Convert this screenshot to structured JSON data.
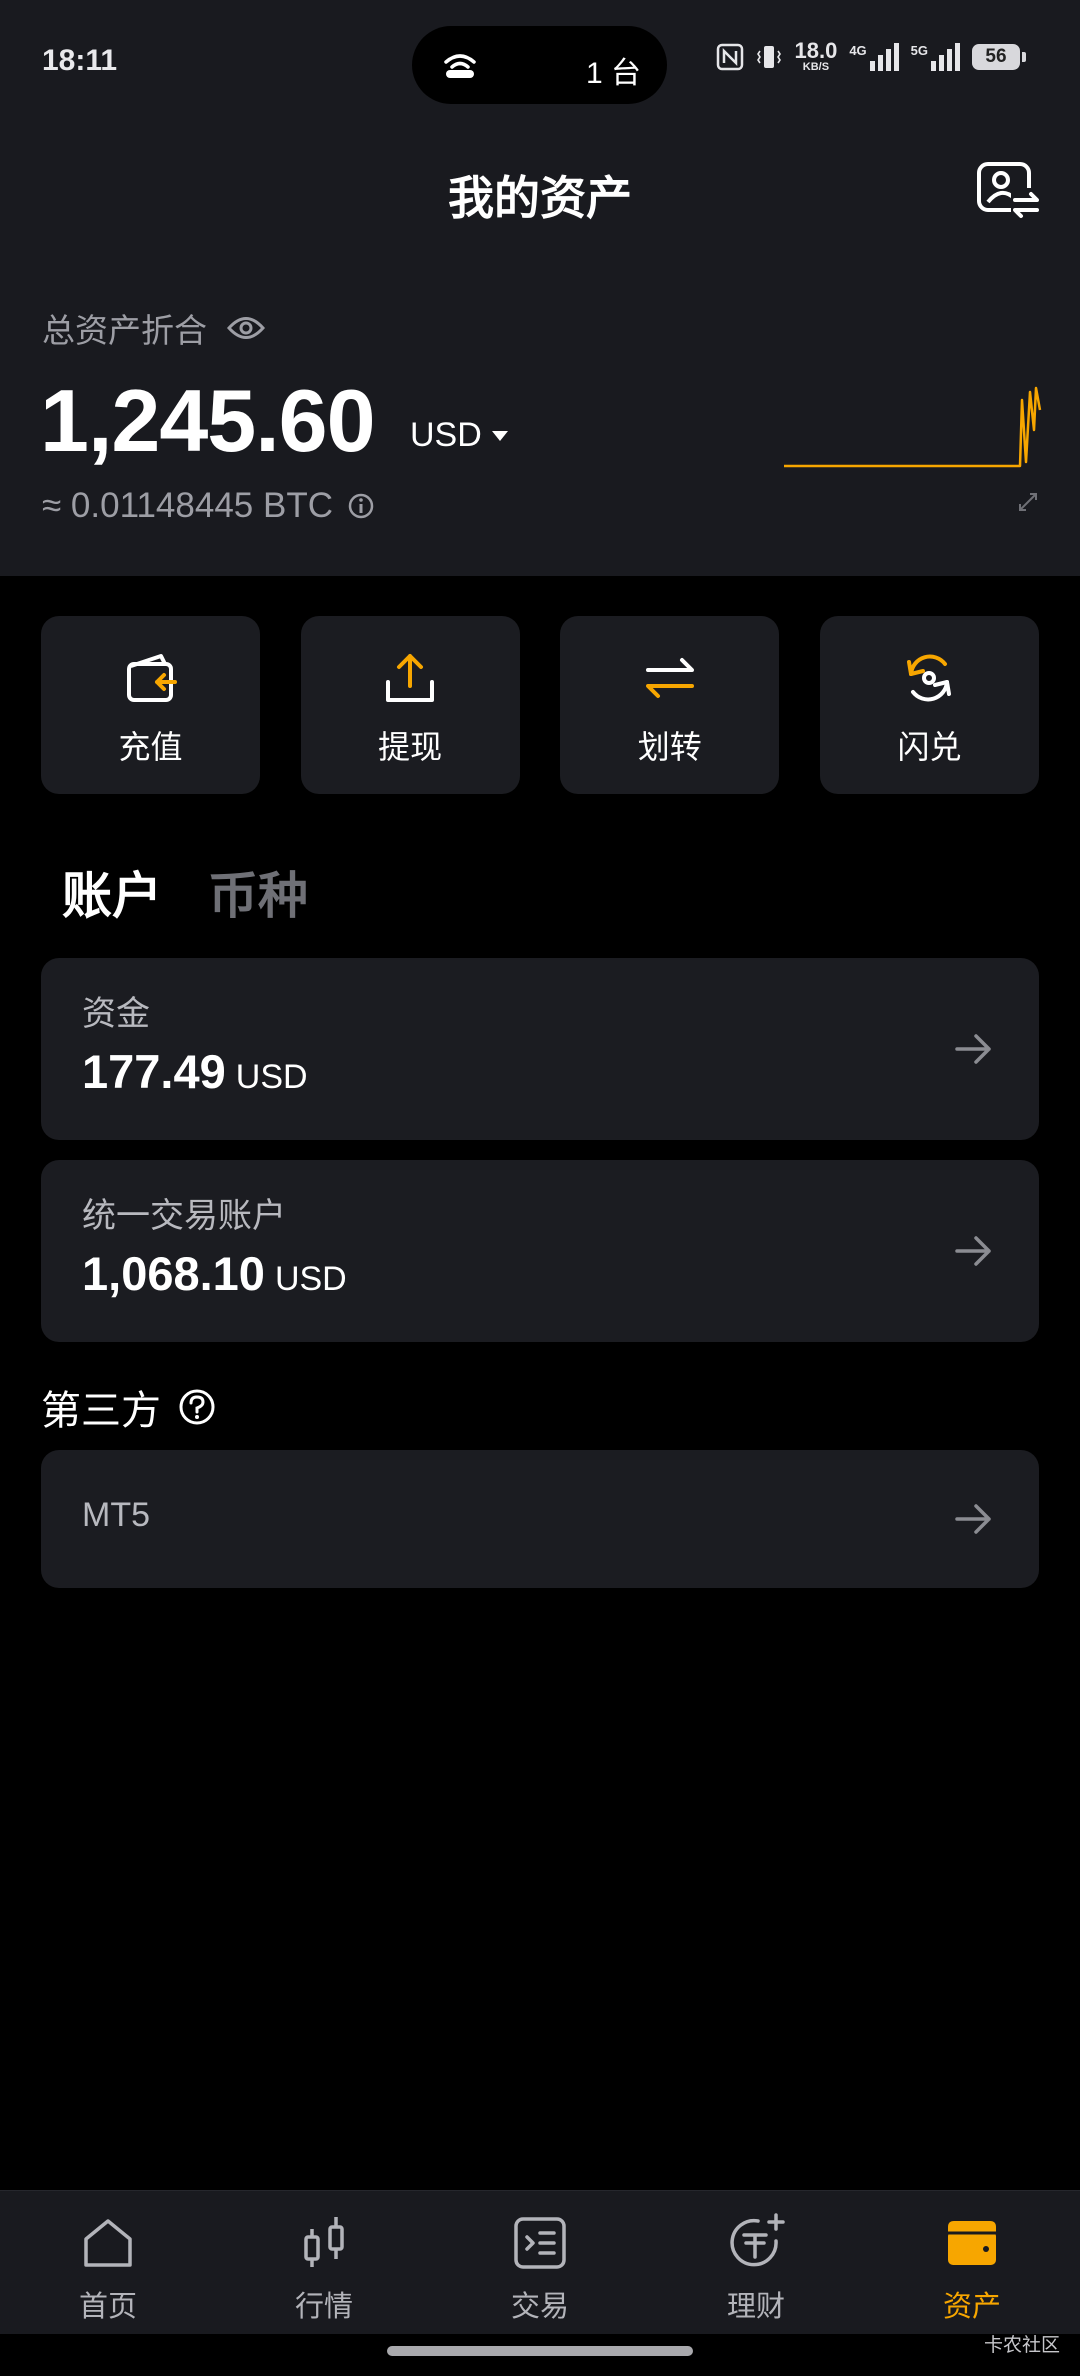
{
  "status_bar": {
    "time": "18:11",
    "island_text": "1 台",
    "net_speed_value": "18.0",
    "net_speed_unit": "KB/S",
    "signal1_label": "4G",
    "signal2_label": "5G",
    "battery": "56"
  },
  "header": {
    "title": "我的资产"
  },
  "summary": {
    "label": "总资产折合",
    "amount": "1,245.60",
    "currency": "USD",
    "btc": "≈ 0.01148445 BTC"
  },
  "actions": [
    {
      "label": "充值",
      "icon": "deposit-icon"
    },
    {
      "label": "提现",
      "icon": "withdraw-icon"
    },
    {
      "label": "划转",
      "icon": "transfer-icon"
    },
    {
      "label": "闪兑",
      "icon": "convert-icon"
    }
  ],
  "tabs": [
    {
      "label": "账户",
      "active": true
    },
    {
      "label": "币种",
      "active": false
    }
  ],
  "accounts": [
    {
      "name": "资金",
      "amount": "177.49",
      "unit": "USD"
    },
    {
      "name": "统一交易账户",
      "amount": "1,068.10",
      "unit": "USD"
    }
  ],
  "third_party": {
    "label": "第三方",
    "items": [
      {
        "name": "MT5"
      }
    ]
  },
  "bottom_nav": [
    {
      "label": "首页",
      "icon": "home-icon"
    },
    {
      "label": "行情",
      "icon": "candlestick-icon"
    },
    {
      "label": "交易",
      "icon": "trade-icon"
    },
    {
      "label": "理财",
      "icon": "earn-icon"
    },
    {
      "label": "资产",
      "icon": "wallet-icon",
      "active": true
    }
  ],
  "watermark": "卡农社区",
  "colors": {
    "accent": "#f7a600",
    "background": "#000000",
    "panel": "#191a1f",
    "card": "#1b1c21",
    "muted_text": "#9d9ea5"
  }
}
